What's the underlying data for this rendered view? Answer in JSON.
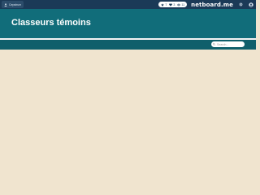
{
  "topbar": {
    "user_label": "Cepstrum",
    "brand": "netboard.me",
    "notifications": [
      {
        "icon": "star-icon",
        "count": "7"
      },
      {
        "icon": "heart-icon",
        "count": "3"
      },
      {
        "icon": "eye-icon",
        "count": "11"
      }
    ]
  },
  "header": {
    "title": "Classeurs témoins"
  },
  "search": {
    "placeholder": "Search..."
  },
  "colors": {
    "topbar": "#1b3a57",
    "header": "#116d7a",
    "subbar": "#0f5f6b",
    "background": "#f0e4cf"
  }
}
